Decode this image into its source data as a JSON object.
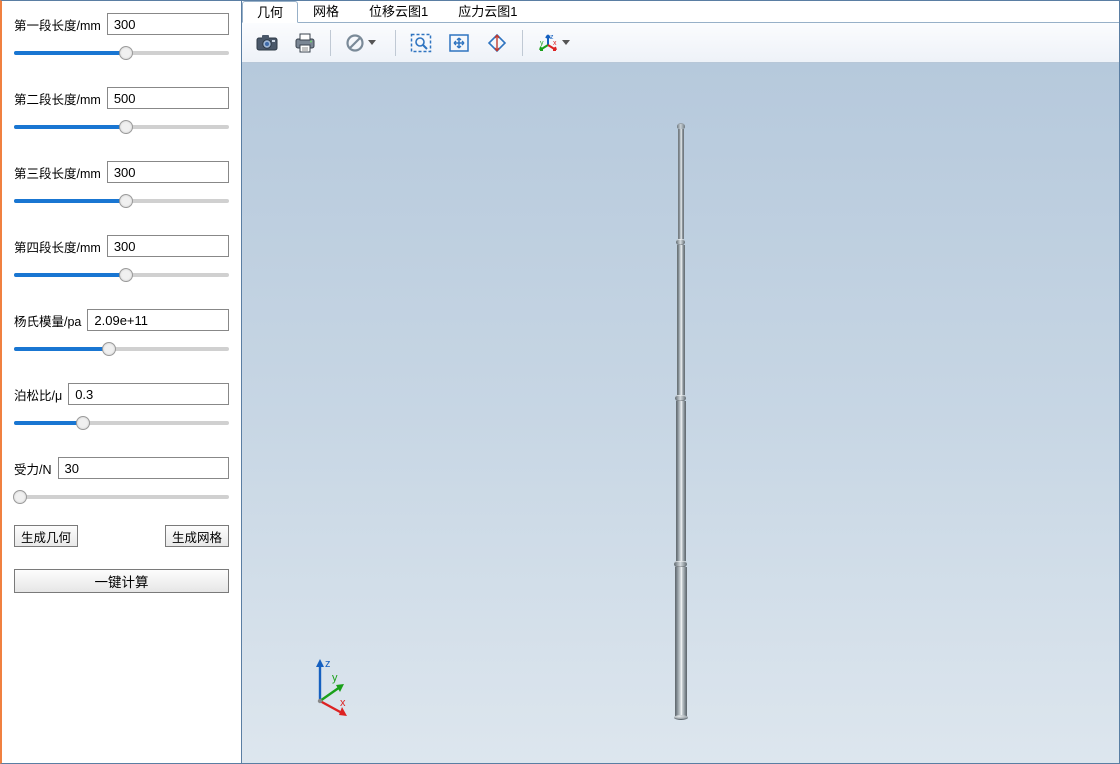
{
  "sidebar": {
    "params": [
      {
        "label": "第一段长度/mm",
        "value": "300",
        "slider_percent": 52
      },
      {
        "label": "第二段长度/mm",
        "value": "500",
        "slider_percent": 52
      },
      {
        "label": "第三段长度/mm",
        "value": "300",
        "slider_percent": 52
      },
      {
        "label": "第四段长度/mm",
        "value": "300",
        "slider_percent": 52
      },
      {
        "label": "杨氏模量/pa",
        "value": "2.09e+11",
        "slider_percent": 44
      },
      {
        "label": "泊松比/μ",
        "value": "0.3",
        "slider_percent": 32
      },
      {
        "label": "受力/N",
        "value": "30",
        "slider_percent": 3
      }
    ],
    "buttons": {
      "gen_geometry": "生成几何",
      "gen_mesh": "生成网格",
      "compute": "一键计算"
    }
  },
  "tabs": [
    {
      "id": "geom",
      "label": "几何",
      "active": true
    },
    {
      "id": "mesh",
      "label": "网格",
      "active": false
    },
    {
      "id": "disp",
      "label": "位移云图1",
      "active": false
    },
    {
      "id": "stress",
      "label": "应力云图1",
      "active": false
    }
  ],
  "toolbar": {
    "items": [
      {
        "name": "screenshot-icon"
      },
      {
        "name": "print-icon"
      },
      {
        "sep": true
      },
      {
        "name": "no-entry-icon",
        "dropdown": true
      },
      {
        "sep": true
      },
      {
        "name": "zoom-window-icon"
      },
      {
        "name": "zoom-extents-icon"
      },
      {
        "name": "zoom-inout-icon"
      },
      {
        "sep": true
      },
      {
        "name": "axis-orientation-icon",
        "dropdown": true
      }
    ]
  },
  "triad": {
    "x": "x",
    "y": "y",
    "z": "z"
  },
  "colors": {
    "accent": "#1976d2",
    "panel_border": "#5a7ea3",
    "viewport_top": "#b6c9dc",
    "viewport_bottom": "#dde6ee"
  }
}
